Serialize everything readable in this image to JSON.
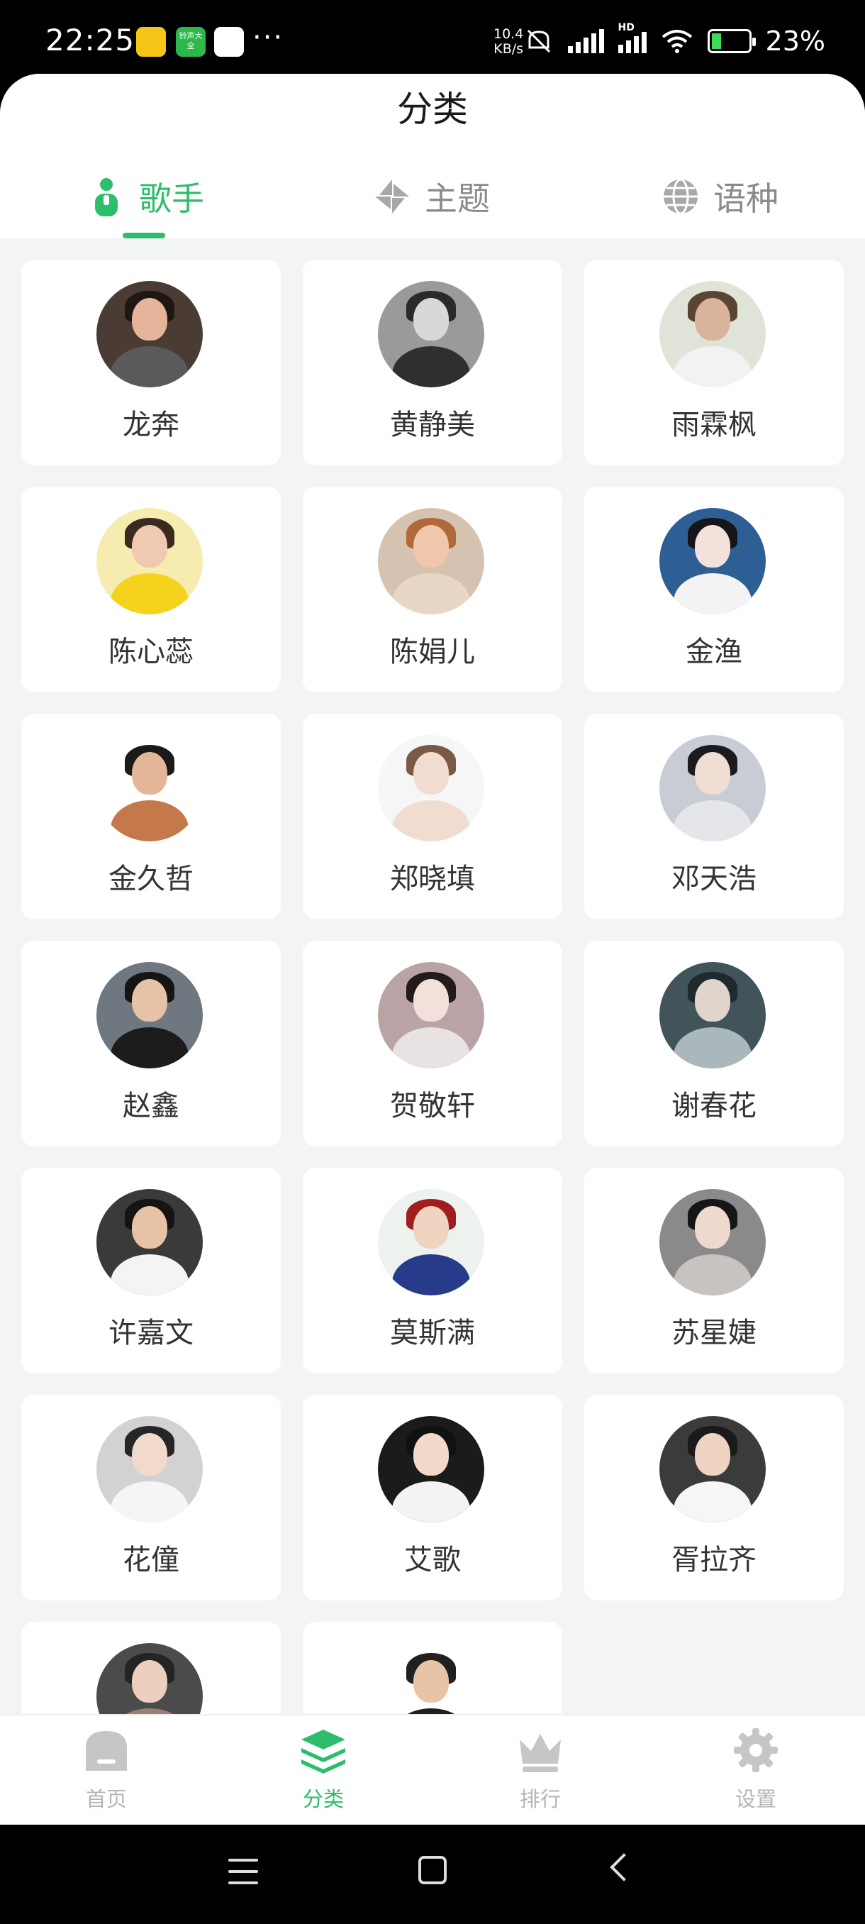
{
  "status_bar": {
    "time": "22:25",
    "dots": "···",
    "net_speed_value": "10.4",
    "net_speed_unit": "KB/s",
    "network_label": "HD",
    "battery": "23%",
    "app2_label": "铃声大全"
  },
  "sheet": {
    "title": "分类",
    "tabs": [
      {
        "label": "歌手",
        "icon": "person-icon",
        "active": true
      },
      {
        "label": "主题",
        "icon": "pinwheel-icon",
        "active": false
      },
      {
        "label": "语种",
        "icon": "globe-icon",
        "active": false
      }
    ]
  },
  "singers": [
    {
      "name": "龙奔",
      "bg": "#4a3b35",
      "skin": "#e4b59a",
      "hair": "#1e1712",
      "cloth": "#5a5a5a"
    },
    {
      "name": "黄静美",
      "bg": "#9a9a9a",
      "skin": "#d8d8d8",
      "hair": "#2a2a2a",
      "cloth": "#2f2f2f"
    },
    {
      "name": "雨霖枫",
      "bg": "#dfe3d8",
      "skin": "#d9b49a",
      "hair": "#5a4534",
      "cloth": "#f2f2f2"
    },
    {
      "name": "陈心蕊",
      "bg": "#f7ecb0",
      "skin": "#f0c9b2",
      "hair": "#3a2a1f",
      "cloth": "#f5d31c"
    },
    {
      "name": "陈娟儿",
      "bg": "#d6c2b0",
      "skin": "#f0c7ad",
      "hair": "#b06a3a",
      "cloth": "#e8d6c6"
    },
    {
      "name": "金渔",
      "bg": "#2d5f95",
      "skin": "#f3e2dc",
      "hair": "#15151a",
      "cloth": "#f3f3f3"
    },
    {
      "name": "金久哲",
      "bg": "#ffffff",
      "skin": "#e2b697",
      "hair": "#1a1a1a",
      "cloth": "#c5794a"
    },
    {
      "name": "郑晓填",
      "bg": "#f6f6f6",
      "skin": "#f1dcd0",
      "hair": "#7a5a45",
      "cloth": "#f1dcd0"
    },
    {
      "name": "邓天浩",
      "bg": "#c8ccd5",
      "skin": "#f0ddd3",
      "hair": "#1a1a1f",
      "cloth": "#e5e6ea"
    },
    {
      "name": "赵鑫",
      "bg": "#6f7880",
      "skin": "#e6c2a6",
      "hair": "#151515",
      "cloth": "#1c1c1c"
    },
    {
      "name": "贺敬轩",
      "bg": "#b9a3a4",
      "skin": "#f3e0da",
      "hair": "#231a1a",
      "cloth": "#e9e2e2"
    },
    {
      "name": "谢春花",
      "bg": "#41545a",
      "skin": "#e0d4cc",
      "hair": "#1e2a2e",
      "cloth": "#aab8bd"
    },
    {
      "name": "许嘉文",
      "bg": "#3a3a3a",
      "skin": "#e8c2a5",
      "hair": "#141414",
      "cloth": "#f4f4f4"
    },
    {
      "name": "莫斯满",
      "bg": "#eef2ef",
      "skin": "#f0d3c1",
      "hair": "#a21e1e",
      "cloth": "#283a8a"
    },
    {
      "name": "苏星婕",
      "bg": "#8b8a8a",
      "skin": "#eed9cf",
      "hair": "#161616",
      "cloth": "#c8c2c0"
    },
    {
      "name": "花僮",
      "bg": "#d2d2d2",
      "skin": "#f1d9cb",
      "hair": "#262626",
      "cloth": "#f5f5f5"
    },
    {
      "name": "艾歌",
      "bg": "#1b1b1b",
      "skin": "#f0d8ca",
      "hair": "#111111",
      "cloth": "#f3f3f3"
    },
    {
      "name": "胥拉齐",
      "bg": "#3b3b3b",
      "skin": "#efd3c1",
      "hair": "#1a1a1a",
      "cloth": "#f6f6f6"
    },
    {
      "name": "",
      "bg": "#4b4b4b",
      "skin": "#eccfbf",
      "hair": "#242424",
      "cloth": "#9a7f74"
    },
    {
      "name": "",
      "bg": "#ffffff",
      "skin": "#e7c3a7",
      "hair": "#202020",
      "cloth": "#1e1e1e"
    }
  ],
  "bottom_nav": [
    {
      "label": "首页",
      "icon": "home-icon",
      "active": false
    },
    {
      "label": "分类",
      "icon": "layers-icon",
      "active": true
    },
    {
      "label": "排行",
      "icon": "crown-icon",
      "active": false
    },
    {
      "label": "设置",
      "icon": "settings-gear-icon",
      "active": false
    }
  ],
  "colors": {
    "accent": "#2dbe6c",
    "inactive": "#b5b5b5",
    "page_bg": "#f2f4f6"
  }
}
